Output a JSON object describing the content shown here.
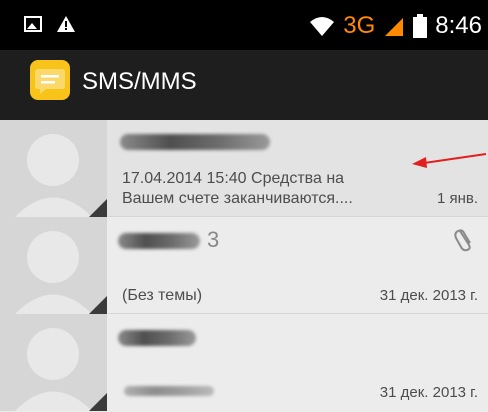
{
  "status_bar": {
    "network_type": "3G",
    "time": "8:46"
  },
  "app": {
    "title": "SMS/MMS",
    "icon": "message-bubble-icon"
  },
  "threads": [
    {
      "count": "",
      "preview_line1": "17.04.2014 15:40 Средства на",
      "preview_line2": "Вашем счете заканчиваются....",
      "date": "1 янв."
    },
    {
      "count": "3",
      "preview_line1": "(Без темы)",
      "preview_line2": "",
      "date": "31 дек. 2013 г."
    },
    {
      "count": "",
      "preview_line1": "",
      "preview_line2": "",
      "date": "31 дек. 2013 г."
    }
  ],
  "colors": {
    "accent_orange": "#ff8a00",
    "app_icon_yellow": "#f8c41a",
    "annotation_red": "#e0201f"
  }
}
